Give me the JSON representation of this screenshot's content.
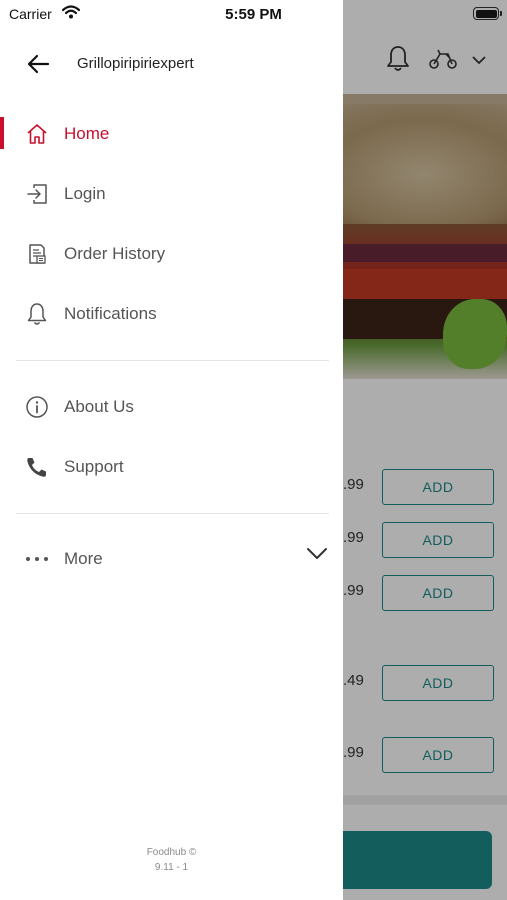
{
  "status_bar": {
    "carrier": "Carrier",
    "time": "5:59 PM"
  },
  "drawer": {
    "store_name": "Grillopiripiriexpert",
    "items": [
      {
        "label": "Home",
        "icon": "home-icon",
        "active": true
      },
      {
        "label": "Login",
        "icon": "login-icon"
      },
      {
        "label": "Order History",
        "icon": "receipt-icon"
      },
      {
        "label": "Notifications",
        "icon": "bell-icon"
      },
      {
        "label": "About Us",
        "icon": "info-icon"
      },
      {
        "label": "Support",
        "icon": "phone-icon"
      },
      {
        "label": "More",
        "icon": "more-icon"
      }
    ],
    "footer_brand": "Foodhub ©",
    "footer_version": "9.11 - 1"
  },
  "background": {
    "add_label": "ADD",
    "prices": [
      ".99",
      ".99",
      ".99",
      ".49",
      ".99"
    ]
  },
  "colors": {
    "accent": "#c8102e",
    "teal": "#1d8a8a",
    "text": "#555555"
  }
}
